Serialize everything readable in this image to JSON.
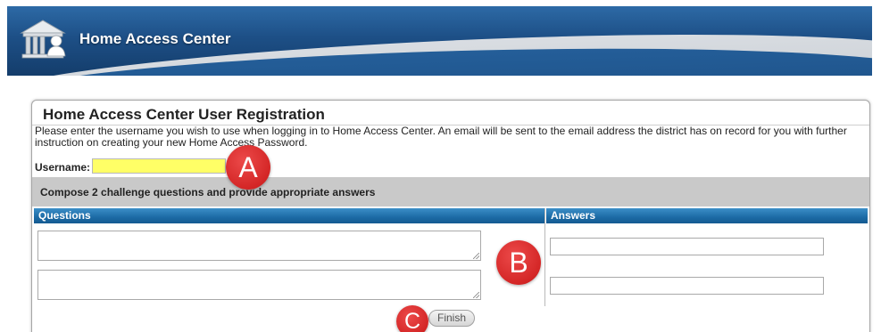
{
  "header": {
    "app_title": "Home Access Center",
    "logo_icon": "building-person-icon"
  },
  "registration": {
    "title": "Home Access Center User Registration",
    "instructions": "Please enter the username you wish to use when logging in to Home Access Center. An email will be sent to the email address the district has on record for you with further instruction on creating your new Home Access Password.",
    "username_label": "Username:",
    "username_value": "",
    "compose_text": "Compose 2 challenge questions and provide appropriate answers",
    "questions_header": "Questions",
    "answers_header": "Answers",
    "question_values": [
      "",
      ""
    ],
    "answer_values": [
      "",
      ""
    ],
    "finish_label": "Finish"
  },
  "annotations": {
    "a": "A",
    "b": "B",
    "c": "C",
    "color": "#d42626"
  },
  "colors": {
    "header_blue": "#1d4f86",
    "column_header_blue": "#1c6aa5",
    "username_highlight": "#ffff66",
    "compose_bar_gray": "#c9c9c9"
  }
}
